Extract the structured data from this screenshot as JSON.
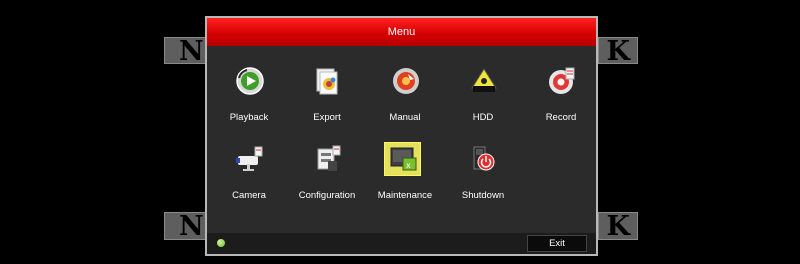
{
  "window": {
    "title": "Menu"
  },
  "background": {
    "watermark_left": "NO",
    "watermark_right": "K"
  },
  "menu": {
    "items": [
      {
        "label": "Playback",
        "icon": "playback-icon"
      },
      {
        "label": "Export",
        "icon": "export-icon"
      },
      {
        "label": "Manual",
        "icon": "manual-icon"
      },
      {
        "label": "HDD",
        "icon": "hdd-icon"
      },
      {
        "label": "Record",
        "icon": "record-icon"
      },
      {
        "label": "Camera",
        "icon": "camera-icon"
      },
      {
        "label": "Configuration",
        "icon": "configuration-icon"
      },
      {
        "label": "Maintenance",
        "icon": "maintenance-icon",
        "selected": true
      },
      {
        "label": "Shutdown",
        "icon": "shutdown-icon"
      }
    ]
  },
  "footer": {
    "exit_label": "Exit",
    "status_color": "#7ccb35"
  },
  "colors": {
    "title_bar": "#e00000",
    "panel": "#2b2b2b",
    "selected_tile": "#e6e05f"
  }
}
